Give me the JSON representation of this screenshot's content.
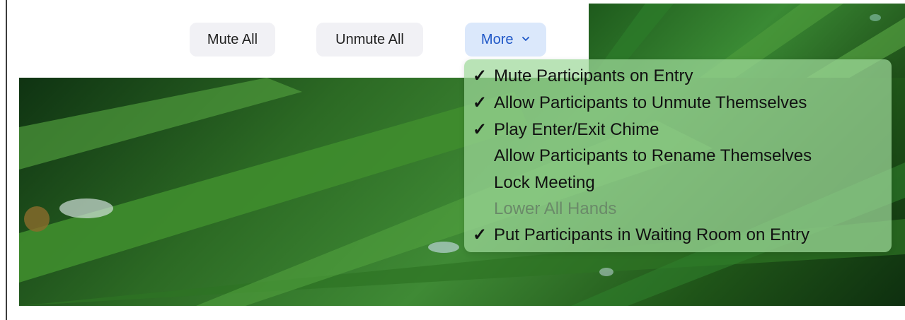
{
  "toolbar": {
    "mute_all_label": "Mute All",
    "unmute_all_label": "Unmute All",
    "more_label": "More"
  },
  "menu": {
    "items": [
      {
        "label": "Mute Participants on Entry",
        "checked": true,
        "enabled": true
      },
      {
        "label": "Allow Participants to Unmute Themselves",
        "checked": true,
        "enabled": true
      },
      {
        "label": "Play Enter/Exit Chime",
        "checked": true,
        "enabled": true
      },
      {
        "label": "Allow Participants to Rename Themselves",
        "checked": false,
        "enabled": true
      },
      {
        "label": "Lock Meeting",
        "checked": false,
        "enabled": true
      },
      {
        "label": "Lower All Hands",
        "checked": false,
        "enabled": false
      },
      {
        "label": "Put Participants in Waiting Room on Entry",
        "checked": true,
        "enabled": true
      }
    ],
    "check_glyph": "✓"
  },
  "icons": {
    "more_chevron": "chevron-down-icon",
    "checkmark": "checkmark-icon"
  },
  "colors": {
    "more_button_bg": "#dbe8fb",
    "more_button_text": "#1f57c7",
    "menu_bg": "#9ed89a"
  }
}
